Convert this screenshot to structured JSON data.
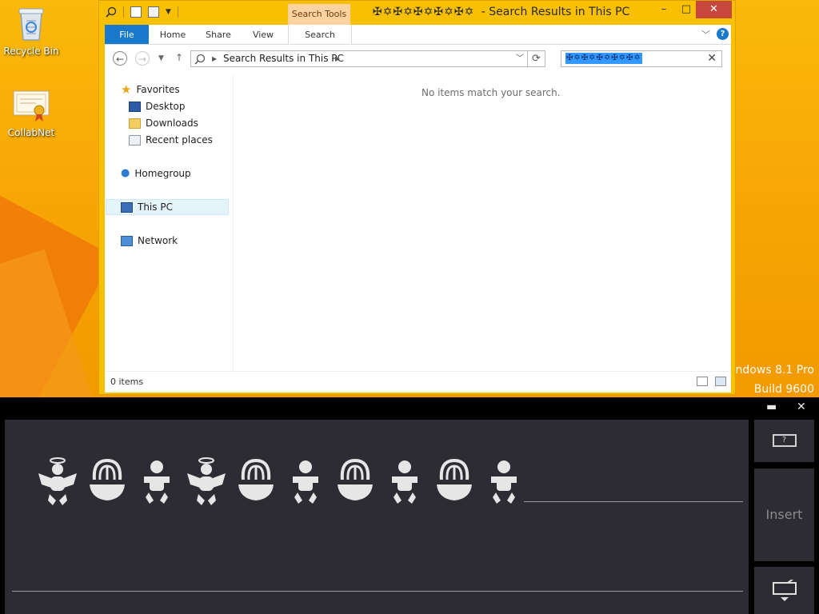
{
  "desktop": {
    "recycle_bin": "Recycle Bin",
    "collabnet": "CollabNet",
    "watermark_line1": "indows 8.1 Pro",
    "watermark_line2": "Build 9600"
  },
  "window": {
    "title": "Search Results in This PC",
    "title_glyphs": "✠✡✠✡✠✡✠✡✠✡",
    "contextual_tab": "Search Tools",
    "ribbon_tabs": [
      "File",
      "Home",
      "Share",
      "View",
      "Search"
    ],
    "active_tab": "Search",
    "help_label": "?"
  },
  "address": {
    "path": "Search Results in This PC"
  },
  "search": {
    "query_glyphs": "✠✡✠✡✠✡✠✡✠✡"
  },
  "navpane": {
    "favorites": "Favorites",
    "desktop": "Desktop",
    "downloads": "Downloads",
    "recent": "Recent places",
    "homegroup": "Homegroup",
    "thispc": "This PC",
    "network": "Network"
  },
  "main": {
    "empty_message": "No items match your search."
  },
  "status": {
    "count": "0 items"
  },
  "math_panel": {
    "insert_label": "Insert",
    "help_label": "?",
    "symbols": [
      "angel-baby",
      "fountain",
      "baby",
      "angel-baby",
      "fountain",
      "baby",
      "fountain",
      "baby",
      "fountain",
      "baby"
    ]
  },
  "colors": {
    "accent": "#1979ca",
    "desktop_orange": "#f7a404",
    "panel_dark": "#2c2c32"
  }
}
